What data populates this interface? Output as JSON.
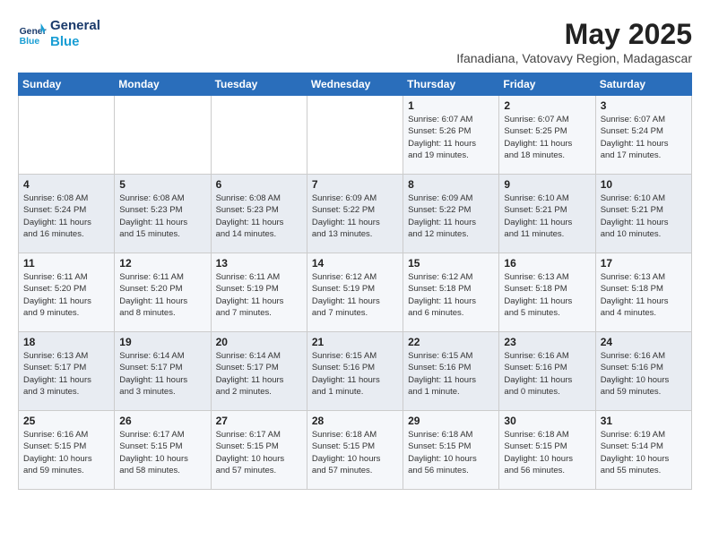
{
  "logo": {
    "line1": "General",
    "line2": "Blue"
  },
  "title": "May 2025",
  "subtitle": "Ifanadiana, Vatovavy Region, Madagascar",
  "weekdays": [
    "Sunday",
    "Monday",
    "Tuesday",
    "Wednesday",
    "Thursday",
    "Friday",
    "Saturday"
  ],
  "weeks": [
    [
      {
        "day": "",
        "info": ""
      },
      {
        "day": "",
        "info": ""
      },
      {
        "day": "",
        "info": ""
      },
      {
        "day": "",
        "info": ""
      },
      {
        "day": "1",
        "info": "Sunrise: 6:07 AM\nSunset: 5:26 PM\nDaylight: 11 hours\nand 19 minutes."
      },
      {
        "day": "2",
        "info": "Sunrise: 6:07 AM\nSunset: 5:25 PM\nDaylight: 11 hours\nand 18 minutes."
      },
      {
        "day": "3",
        "info": "Sunrise: 6:07 AM\nSunset: 5:24 PM\nDaylight: 11 hours\nand 17 minutes."
      }
    ],
    [
      {
        "day": "4",
        "info": "Sunrise: 6:08 AM\nSunset: 5:24 PM\nDaylight: 11 hours\nand 16 minutes."
      },
      {
        "day": "5",
        "info": "Sunrise: 6:08 AM\nSunset: 5:23 PM\nDaylight: 11 hours\nand 15 minutes."
      },
      {
        "day": "6",
        "info": "Sunrise: 6:08 AM\nSunset: 5:23 PM\nDaylight: 11 hours\nand 14 minutes."
      },
      {
        "day": "7",
        "info": "Sunrise: 6:09 AM\nSunset: 5:22 PM\nDaylight: 11 hours\nand 13 minutes."
      },
      {
        "day": "8",
        "info": "Sunrise: 6:09 AM\nSunset: 5:22 PM\nDaylight: 11 hours\nand 12 minutes."
      },
      {
        "day": "9",
        "info": "Sunrise: 6:10 AM\nSunset: 5:21 PM\nDaylight: 11 hours\nand 11 minutes."
      },
      {
        "day": "10",
        "info": "Sunrise: 6:10 AM\nSunset: 5:21 PM\nDaylight: 11 hours\nand 10 minutes."
      }
    ],
    [
      {
        "day": "11",
        "info": "Sunrise: 6:11 AM\nSunset: 5:20 PM\nDaylight: 11 hours\nand 9 minutes."
      },
      {
        "day": "12",
        "info": "Sunrise: 6:11 AM\nSunset: 5:20 PM\nDaylight: 11 hours\nand 8 minutes."
      },
      {
        "day": "13",
        "info": "Sunrise: 6:11 AM\nSunset: 5:19 PM\nDaylight: 11 hours\nand 7 minutes."
      },
      {
        "day": "14",
        "info": "Sunrise: 6:12 AM\nSunset: 5:19 PM\nDaylight: 11 hours\nand 7 minutes."
      },
      {
        "day": "15",
        "info": "Sunrise: 6:12 AM\nSunset: 5:18 PM\nDaylight: 11 hours\nand 6 minutes."
      },
      {
        "day": "16",
        "info": "Sunrise: 6:13 AM\nSunset: 5:18 PM\nDaylight: 11 hours\nand 5 minutes."
      },
      {
        "day": "17",
        "info": "Sunrise: 6:13 AM\nSunset: 5:18 PM\nDaylight: 11 hours\nand 4 minutes."
      }
    ],
    [
      {
        "day": "18",
        "info": "Sunrise: 6:13 AM\nSunset: 5:17 PM\nDaylight: 11 hours\nand 3 minutes."
      },
      {
        "day": "19",
        "info": "Sunrise: 6:14 AM\nSunset: 5:17 PM\nDaylight: 11 hours\nand 3 minutes."
      },
      {
        "day": "20",
        "info": "Sunrise: 6:14 AM\nSunset: 5:17 PM\nDaylight: 11 hours\nand 2 minutes."
      },
      {
        "day": "21",
        "info": "Sunrise: 6:15 AM\nSunset: 5:16 PM\nDaylight: 11 hours\nand 1 minute."
      },
      {
        "day": "22",
        "info": "Sunrise: 6:15 AM\nSunset: 5:16 PM\nDaylight: 11 hours\nand 1 minute."
      },
      {
        "day": "23",
        "info": "Sunrise: 6:16 AM\nSunset: 5:16 PM\nDaylight: 11 hours\nand 0 minutes."
      },
      {
        "day": "24",
        "info": "Sunrise: 6:16 AM\nSunset: 5:16 PM\nDaylight: 10 hours\nand 59 minutes."
      }
    ],
    [
      {
        "day": "25",
        "info": "Sunrise: 6:16 AM\nSunset: 5:15 PM\nDaylight: 10 hours\nand 59 minutes."
      },
      {
        "day": "26",
        "info": "Sunrise: 6:17 AM\nSunset: 5:15 PM\nDaylight: 10 hours\nand 58 minutes."
      },
      {
        "day": "27",
        "info": "Sunrise: 6:17 AM\nSunset: 5:15 PM\nDaylight: 10 hours\nand 57 minutes."
      },
      {
        "day": "28",
        "info": "Sunrise: 6:18 AM\nSunset: 5:15 PM\nDaylight: 10 hours\nand 57 minutes."
      },
      {
        "day": "29",
        "info": "Sunrise: 6:18 AM\nSunset: 5:15 PM\nDaylight: 10 hours\nand 56 minutes."
      },
      {
        "day": "30",
        "info": "Sunrise: 6:18 AM\nSunset: 5:15 PM\nDaylight: 10 hours\nand 56 minutes."
      },
      {
        "day": "31",
        "info": "Sunrise: 6:19 AM\nSunset: 5:14 PM\nDaylight: 10 hours\nand 55 minutes."
      }
    ]
  ]
}
